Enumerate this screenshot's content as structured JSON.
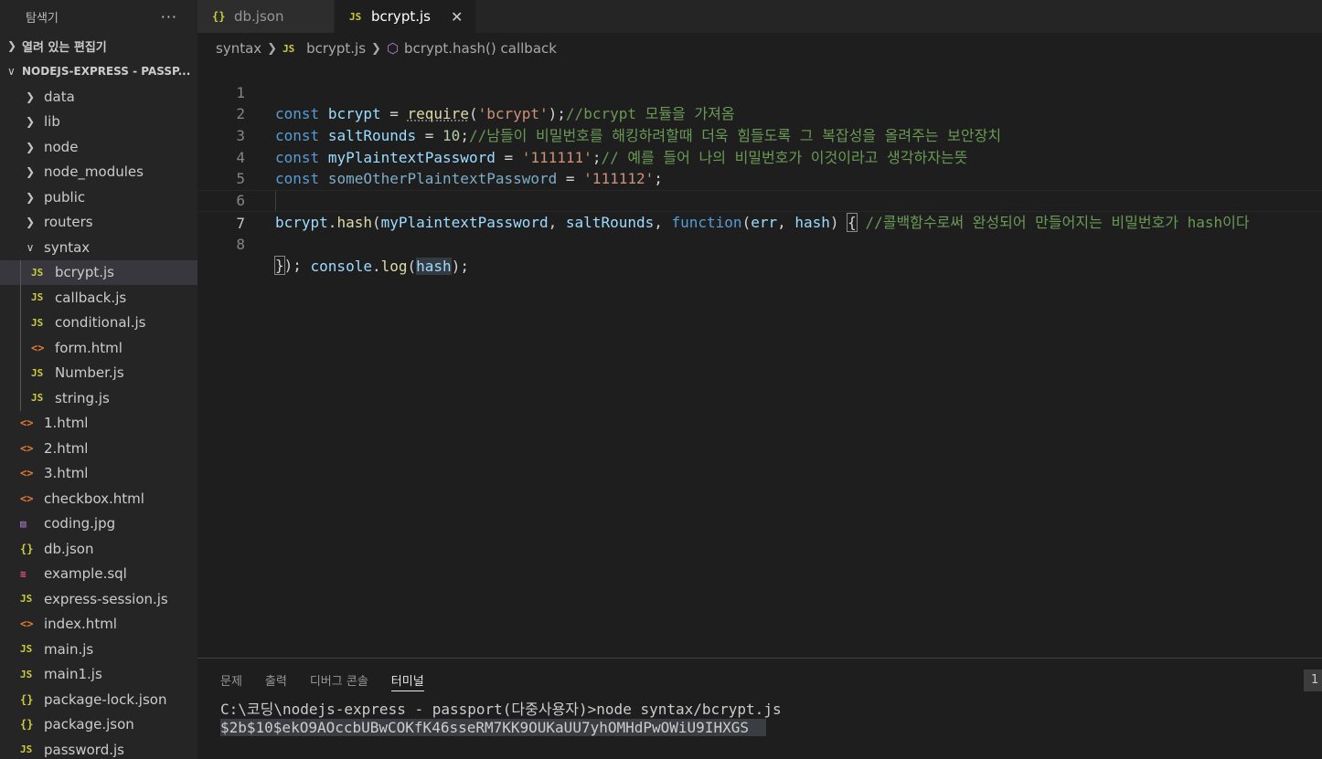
{
  "sidebar": {
    "title": "탐색기",
    "more_label": "···",
    "open_editors_label": "열려 있는 편집기",
    "project_label": "NODEJS-EXPRESS - PASSP...",
    "folders": [
      {
        "name": "data"
      },
      {
        "name": "lib"
      },
      {
        "name": "node"
      },
      {
        "name": "node_modules"
      },
      {
        "name": "public"
      },
      {
        "name": "routers"
      }
    ],
    "open_folder": "syntax",
    "syntax_files": [
      {
        "icon": "JS",
        "name": "bcrypt.js"
      },
      {
        "icon": "JS",
        "name": "callback.js"
      },
      {
        "icon": "JS",
        "name": "conditional.js"
      },
      {
        "icon": "<>",
        "name": "form.html"
      },
      {
        "icon": "JS",
        "name": "Number.js"
      },
      {
        "icon": "JS",
        "name": "string.js"
      }
    ],
    "root_files": [
      {
        "icon": "<>",
        "name": "1.html"
      },
      {
        "icon": "<>",
        "name": "2.html"
      },
      {
        "icon": "<>",
        "name": "3.html"
      },
      {
        "icon": "<>",
        "name": "checkbox.html"
      },
      {
        "icon": "▨",
        "name": "coding.jpg"
      },
      {
        "icon": "{}",
        "name": "db.json"
      },
      {
        "icon": "≋",
        "name": "example.sql"
      },
      {
        "icon": "JS",
        "name": "express-session.js"
      },
      {
        "icon": "<>",
        "name": "index.html"
      },
      {
        "icon": "JS",
        "name": "main.js"
      },
      {
        "icon": "JS",
        "name": "main1.js"
      },
      {
        "icon": "{}",
        "name": "package-lock.json"
      },
      {
        "icon": "{}",
        "name": "package.json"
      },
      {
        "icon": "JS",
        "name": "password.js"
      }
    ]
  },
  "tabs": [
    {
      "icon": "{}",
      "label": "db.json",
      "active": false
    },
    {
      "icon": "JS",
      "label": "bcrypt.js",
      "active": true,
      "close": "✕"
    }
  ],
  "breadcrumb": {
    "folder": "syntax",
    "file_icon": "JS",
    "file": "bcrypt.js",
    "symbol": "bcrypt.hash() callback"
  },
  "editor": {
    "line_numbers": [
      "1",
      "2",
      "3",
      "4",
      "5",
      "6",
      "7",
      "8"
    ],
    "l1": {
      "kw": "const",
      "var": "bcrypt",
      "eq": " = ",
      "fn": "require",
      "p1": "(",
      "str": "'bcrypt'",
      "p2": ");",
      "cm": "//bcrypt 모듈을 가져옴"
    },
    "l2": {
      "kw": "const",
      "var": "saltRounds",
      "eq": " = ",
      "num": "10",
      "semi": ";",
      "cm": "//남들이 비밀번호를 해킹하려할때 더욱 힘들도록 그 복잡성을 올려주는 보안장치"
    },
    "l3": {
      "kw": "const",
      "var": "myPlaintextPassword",
      "eq": " = ",
      "str": "'111111'",
      "semi": ";",
      "cm": "// 예를 들어 나의 비밀번호가 이것이라고 생각하자는뜻"
    },
    "l4": {
      "kw": "const",
      "var": "someOtherPlaintextPassword",
      "eq": " = ",
      "str": "'111112'",
      "semi": ";"
    },
    "l6": {
      "obj": "bcrypt",
      "dot": ".",
      "fn": "hash",
      "p1": "(",
      "a1": "myPlaintextPassword",
      "c1": ", ",
      "a2": "saltRounds",
      "c2": ", ",
      "kw": "function",
      "p2": "(",
      "a3": "err",
      "c3": ", ",
      "a4": "hash",
      "p3": ") ",
      "brace": "{",
      "sp": " ",
      "cm": "//콜백함수로써 완성되어 만들어지는 비밀번호가 hash이다"
    },
    "l7": {
      "indent": "    ",
      "obj": "console",
      "dot": ".",
      "fn": "log",
      "p1": "(",
      "arg": "hash",
      "p2": ");"
    },
    "l8": {
      "brace": "}",
      "rest": ");"
    }
  },
  "panel": {
    "tabs": [
      "문제",
      "출력",
      "디버그 콘솔",
      "터미널"
    ],
    "active_tab": "터미널",
    "badge": "1",
    "terminal_lines": [
      "C:\\코딩\\nodejs-express - passport(다중사용자)>node syntax/bcrypt.js",
      "$2b$10$ekO9AOccbUBwCOKfK46sseRM7KK9OUKaUU7yhOMHdPwOWiU9IHXGS  "
    ]
  },
  "colors": {
    "keyword": "#569cd6",
    "variable": "#9cdcfe",
    "function": "#dcdcaa",
    "string": "#ce9178",
    "number": "#b5cea8",
    "comment": "#6a9955",
    "background": "#1e1e1e",
    "sidebar": "#252526"
  }
}
